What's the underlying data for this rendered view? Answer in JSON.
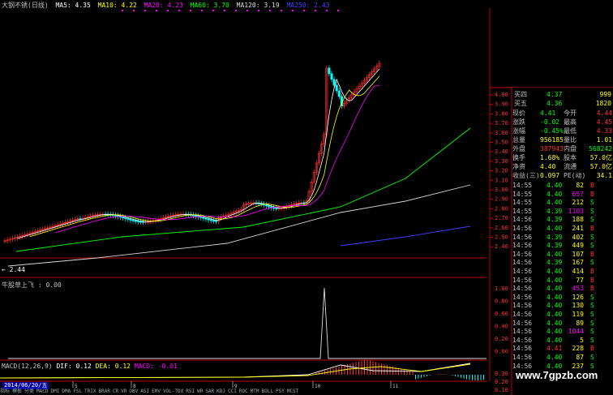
{
  "header": {
    "title": "大钢不锈(日线)",
    "ma5": "MA5: 4.35",
    "ma10": "MA10: 4.22",
    "ma20": "MA20: 4.23",
    "ma60": "MA60: 3.70",
    "ma120": "MA120: 3.19",
    "ma250": "MA250: 2.43"
  },
  "colors": {
    "ma5": "#ffffff",
    "ma10": "#ffff00",
    "ma20": "#ff00ff",
    "ma60": "#00ff00",
    "ma120": "#d8d8d8",
    "ma250": "#4040ff",
    "up": "#ff3030",
    "down": "#00ffff"
  },
  "price_axis": [
    "4.00",
    "3.90",
    "3.80",
    "3.70",
    "3.60",
    "3.50",
    "3.40",
    "3.30",
    "3.20",
    "3.10",
    "3.00",
    "2.90",
    "2.80",
    "2.70",
    "2.60",
    "2.50",
    "2.40"
  ],
  "low_label": "← 2.44",
  "indicator": {
    "title": "牛股草上飞 : 0.00",
    "axis": [
      "1.00",
      "0.80",
      "0.60",
      "0.40",
      "0.20",
      "0.00"
    ]
  },
  "macd": {
    "title_prefix": "MACD(12,26,9)",
    "dif": "DIF: 0.12",
    "dea": "DEA: 0.12",
    "macd": "MACD: -0.01",
    "axis": [
      "0.30",
      "0.20",
      "0.10"
    ]
  },
  "date_label": "2014/06/20/五",
  "month_ticks": [
    "5",
    "8",
    "9",
    "10",
    "11"
  ],
  "book": [
    {
      "label": "买四",
      "price": "4.37",
      "vol": "999"
    },
    {
      "label": "买五",
      "price": "4.36",
      "vol": "1820"
    }
  ],
  "quote": [
    {
      "l1": "现价",
      "v1": "4.41",
      "l2": "今开",
      "v2": "4.44"
    },
    {
      "l1": "涨跌",
      "v1": "-0.02",
      "l2": "最高",
      "v2": "4.45"
    },
    {
      "l1": "涨幅",
      "v1": "-0.45%",
      "l2": "最低",
      "v2": "4.33"
    },
    {
      "l1": "总量",
      "v1": "956185",
      "l2": "量比",
      "v2": "1.01"
    },
    {
      "l1": "外盘",
      "v1": "387943",
      "l2": "内盘",
      "v2": "568242"
    },
    {
      "l1": "换手",
      "v1": "1.68%",
      "l2": "股本",
      "v2": "57.0亿"
    },
    {
      "l1": "净资",
      "v1": "4.40",
      "l2": "流通",
      "v2": "57.0亿"
    },
    {
      "l1": "收益(三)",
      "v1": "0.097",
      "l2": "PE(动)",
      "v2": "34.1"
    }
  ],
  "ticks": [
    {
      "t": "14:55",
      "p": "4.40",
      "v": "82",
      "s": "B"
    },
    {
      "t": "14:55",
      "p": "4.40",
      "v": "657",
      "s": "B"
    },
    {
      "t": "14:55",
      "p": "4.40",
      "v": "212",
      "s": "S"
    },
    {
      "t": "14:55",
      "p": "4.39",
      "v": "1103",
      "s": "S"
    },
    {
      "t": "14:56",
      "p": "4.39",
      "v": "188",
      "s": "S"
    },
    {
      "t": "14:56",
      "p": "4.40",
      "v": "241",
      "s": "B"
    },
    {
      "t": "14:56",
      "p": "4.39",
      "v": "402",
      "s": "S"
    },
    {
      "t": "14:56",
      "p": "4.39",
      "v": "449",
      "s": "S"
    },
    {
      "t": "14:56",
      "p": "4.40",
      "v": "107",
      "s": "B"
    },
    {
      "t": "14:56",
      "p": "4.39",
      "v": "167",
      "s": "S"
    },
    {
      "t": "14:56",
      "p": "4.40",
      "v": "414",
      "s": "B"
    },
    {
      "t": "14:56",
      "p": "4.40",
      "v": "77",
      "s": "B"
    },
    {
      "t": "14:56",
      "p": "4.40",
      "v": "453",
      "s": "B"
    },
    {
      "t": "14:56",
      "p": "4.40",
      "v": "126",
      "s": "S"
    },
    {
      "t": "14:56",
      "p": "4.40",
      "v": "130",
      "s": "S"
    },
    {
      "t": "14:56",
      "p": "4.40",
      "v": "119",
      "s": "S"
    },
    {
      "t": "14:56",
      "p": "4.40",
      "v": "89",
      "s": "S"
    },
    {
      "t": "14:56",
      "p": "4.40",
      "v": "1044",
      "s": "S"
    },
    {
      "t": "14:56",
      "p": "4.40",
      "v": "5",
      "s": "S"
    },
    {
      "t": "14:56",
      "p": "4.41",
      "v": "228",
      "s": "B"
    },
    {
      "t": "14:56",
      "p": "4.40",
      "v": "87",
      "s": "S"
    },
    {
      "t": "14:56",
      "p": "4.40",
      "v": "237",
      "s": "S"
    }
  ],
  "tabs": [
    "指标",
    "模板",
    "分类",
    "MACD",
    "DMI",
    "DMA",
    "FSL",
    "TRIX",
    "BRAR",
    "CR",
    "VR",
    "OBV",
    "ASI",
    "EMV",
    "VOL-TDX",
    "RSI",
    "WR",
    "SAR",
    "KDJ",
    "CCI",
    "ROC",
    "MTM",
    "BOLL",
    "PSY",
    "MCST"
  ],
  "watermark": "www.7gpzb.com"
}
